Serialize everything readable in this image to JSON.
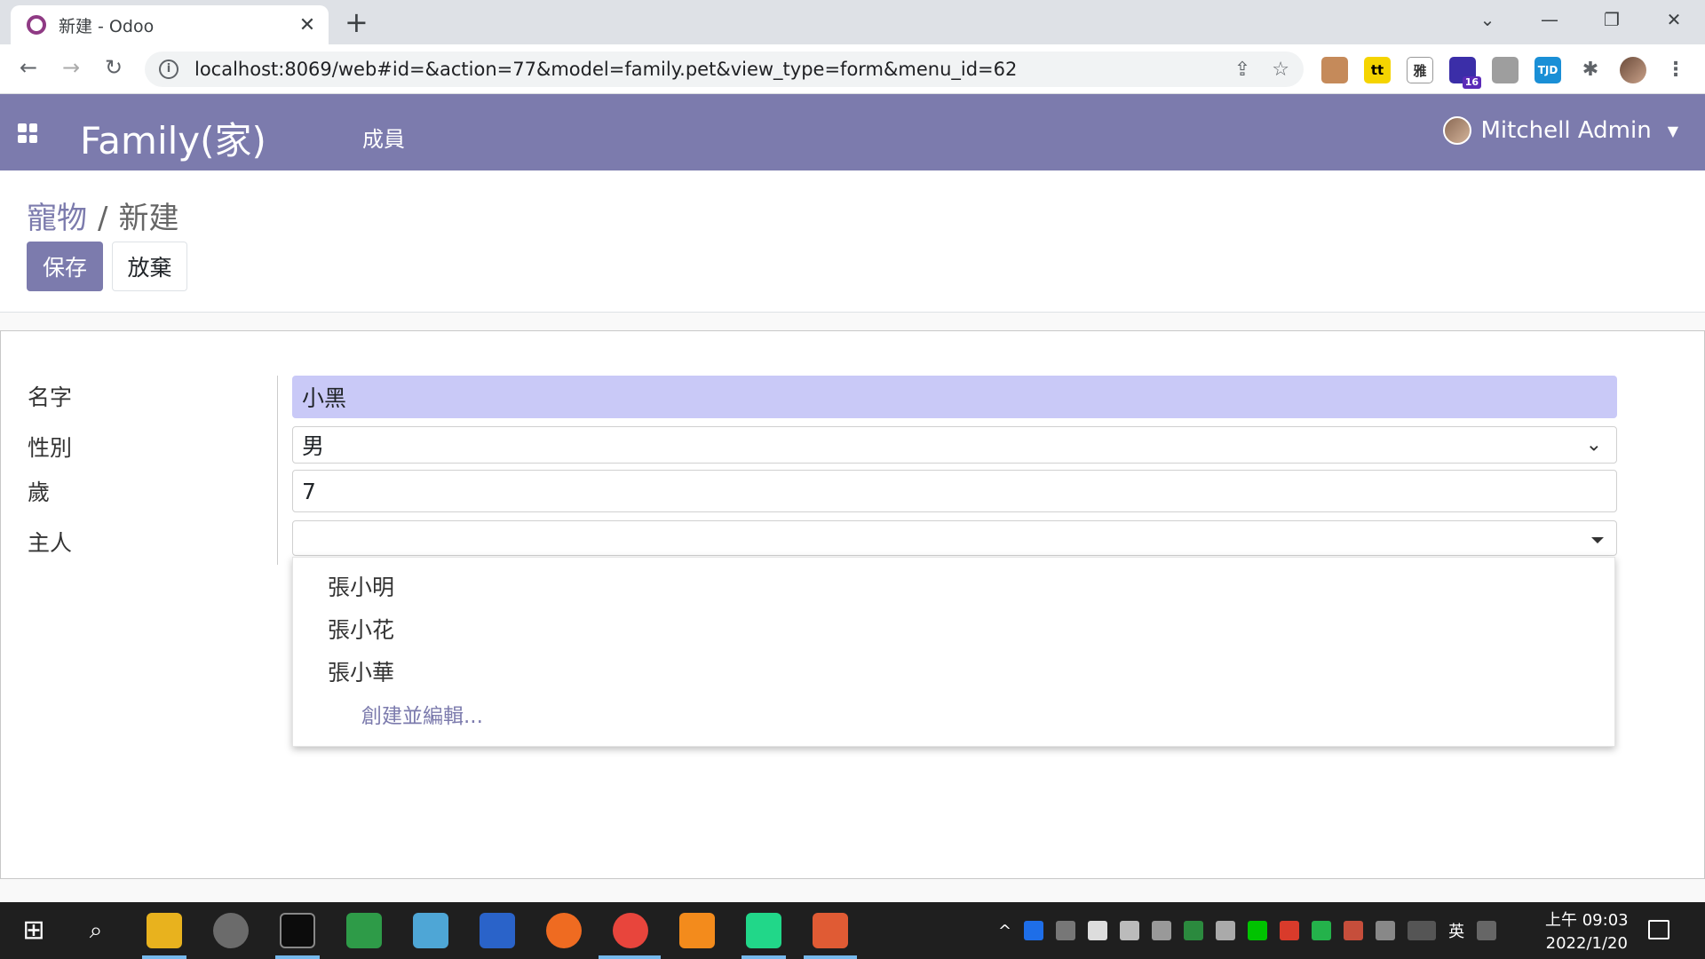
{
  "browser": {
    "tab_title": "新建 - Odoo",
    "url": "localhost:8069/web#id=&action=77&model=family.pet&view_type=form&menu_id=62",
    "win_minimize": "—",
    "win_restore": "❐",
    "win_close": "✕",
    "extension_badge": "16",
    "ext_labels": {
      "tt": "tt",
      "ya": "雅",
      "tjd": "TJD"
    }
  },
  "navbar": {
    "app_title": "Family(家)",
    "menu_members": "成員",
    "user_name": "Mitchell Admin"
  },
  "breadcrumb": {
    "parent": "寵物",
    "separator": "/",
    "current": "新建"
  },
  "buttons": {
    "save": "保存",
    "discard": "放棄"
  },
  "form": {
    "name_label": "名字",
    "name_value": "小黑",
    "gender_label": "性別",
    "gender_value": "男",
    "age_label": "歲",
    "age_value": "7",
    "owner_label": "主人",
    "owner_value": ""
  },
  "owner_dropdown": {
    "options": [
      "張小明",
      "張小花",
      "張小華"
    ],
    "create_edit": "創建並編輯..."
  },
  "taskbar": {
    "ime_lang": "英",
    "time": "上午 09:03",
    "date": "2022/1/20"
  },
  "colors": {
    "odoo_primary": "#7c7bad",
    "name_field_bg": "#c9c9f7",
    "taskbar_bg": "#1f1f1f"
  }
}
